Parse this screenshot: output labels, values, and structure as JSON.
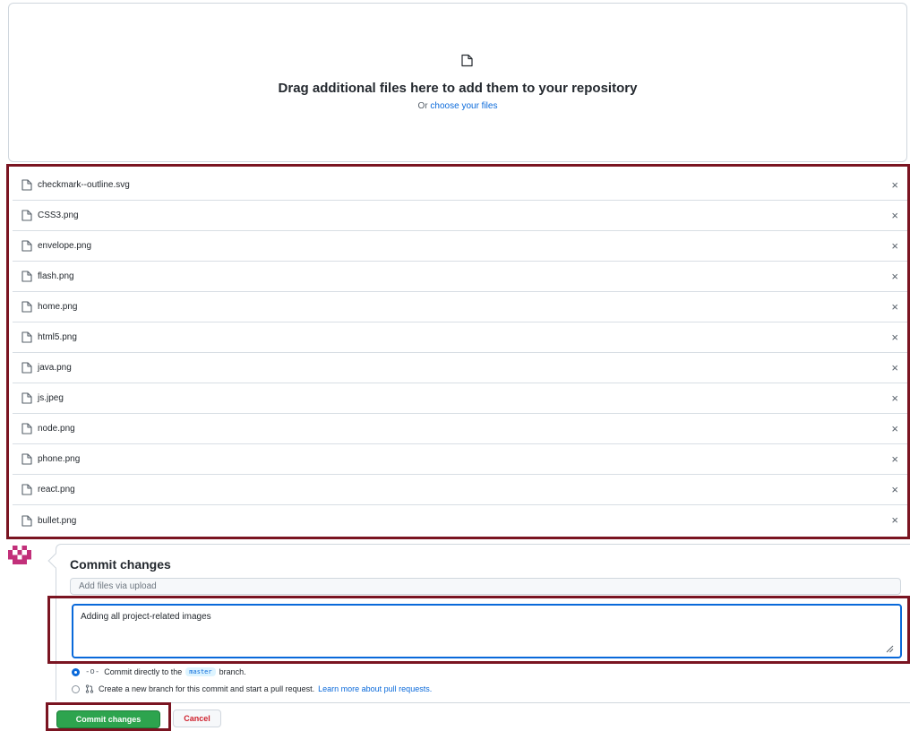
{
  "upload": {
    "title": "Drag additional files here to add them to your repository",
    "or_text": "Or",
    "choose_link": "choose your files"
  },
  "files": [
    {
      "name": "checkmark--outline.svg"
    },
    {
      "name": "CSS3.png"
    },
    {
      "name": "envelope.png"
    },
    {
      "name": "flash.png"
    },
    {
      "name": "home.png"
    },
    {
      "name": "html5.png"
    },
    {
      "name": "java.png"
    },
    {
      "name": "js.jpeg"
    },
    {
      "name": "node.png"
    },
    {
      "name": "phone.png"
    },
    {
      "name": "react.png"
    },
    {
      "name": "bullet.png"
    }
  ],
  "remove_glyph": "×",
  "commit": {
    "title": "Commit changes",
    "summary_placeholder": "Add files via upload",
    "description": "Adding all project-related images",
    "option_direct_prefix": "Commit directly to the",
    "branch": "master",
    "option_direct_suffix": "branch.",
    "option_new_branch": "Create a new branch for this commit and start a pull request.",
    "learn_more": "Learn more about pull requests.",
    "commit_button": "Commit changes",
    "cancel_button": "Cancel"
  },
  "colors": {
    "highlight_border": "#7a1421",
    "primary_button": "#2da44e",
    "link": "#0969da",
    "cancel_text": "#cf222e"
  }
}
